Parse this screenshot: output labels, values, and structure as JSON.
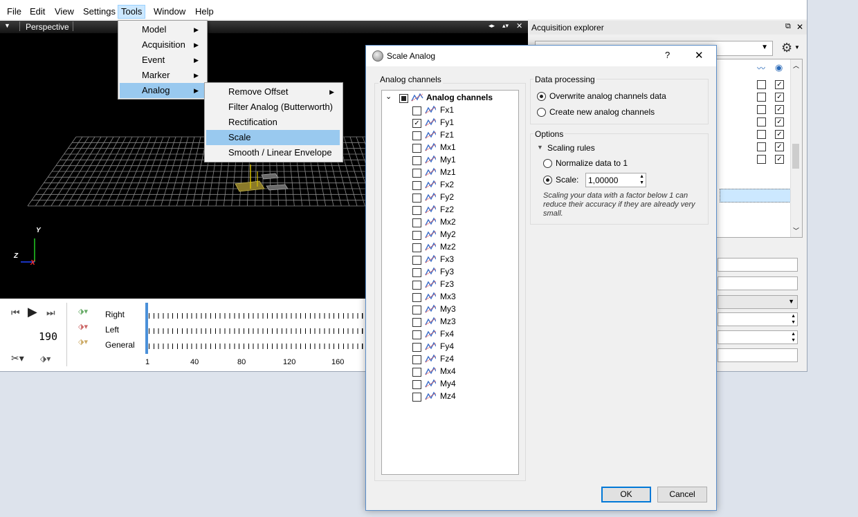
{
  "menubar": {
    "items": [
      "File",
      "Edit",
      "View",
      "Settings",
      "Tools",
      "Window",
      "Help"
    ]
  },
  "viewport": {
    "title": "Perspective",
    "axes": {
      "y": "Y",
      "z": "Z",
      "x": "X"
    }
  },
  "tools_menu": {
    "items": [
      {
        "label": "Model",
        "submenu": true
      },
      {
        "label": "Acquisition",
        "submenu": true
      },
      {
        "label": "Event",
        "submenu": true
      },
      {
        "label": "Marker",
        "submenu": true
      },
      {
        "label": "Analog",
        "submenu": true
      }
    ]
  },
  "analog_menu": {
    "items": [
      {
        "label": "Remove Offset",
        "submenu": true
      },
      {
        "label": "Filter Analog (Butterworth)",
        "submenu": false
      },
      {
        "label": "Rectification",
        "submenu": false
      },
      {
        "label": "Scale",
        "submenu": false
      },
      {
        "label": "Smooth / Linear Envelope",
        "submenu": false
      }
    ],
    "selected": "Scale"
  },
  "timeline": {
    "frame": "190",
    "tracks": [
      "Right",
      "Left",
      "General"
    ],
    "ticks": [
      "1",
      "40",
      "80",
      "120",
      "160"
    ]
  },
  "acquisition_explorer": {
    "title": "Acquisition explorer",
    "checkbox_rows": [
      {
        "a": false,
        "b": true
      },
      {
        "a": false,
        "b": true
      },
      {
        "a": false,
        "b": true
      },
      {
        "a": false,
        "b": true
      },
      {
        "a": false,
        "b": true
      },
      {
        "a": false,
        "b": true
      },
      {
        "a": false,
        "b": true
      }
    ]
  },
  "dialog": {
    "title": "Scale Analog",
    "help": "?",
    "close": "✕",
    "analog_group_title": "Analog channels",
    "tree_root": "Analog channels",
    "channels": [
      {
        "label": "Fx1",
        "checked": false
      },
      {
        "label": "Fy1",
        "checked": true
      },
      {
        "label": "Fz1",
        "checked": false
      },
      {
        "label": "Mx1",
        "checked": false
      },
      {
        "label": "My1",
        "checked": false
      },
      {
        "label": "Mz1",
        "checked": false
      },
      {
        "label": "Fx2",
        "checked": false
      },
      {
        "label": "Fy2",
        "checked": false
      },
      {
        "label": "Fz2",
        "checked": false
      },
      {
        "label": "Mx2",
        "checked": false
      },
      {
        "label": "My2",
        "checked": false
      },
      {
        "label": "Mz2",
        "checked": false
      },
      {
        "label": "Fx3",
        "checked": false
      },
      {
        "label": "Fy3",
        "checked": false
      },
      {
        "label": "Fz3",
        "checked": false
      },
      {
        "label": "Mx3",
        "checked": false
      },
      {
        "label": "My3",
        "checked": false
      },
      {
        "label": "Mz3",
        "checked": false
      },
      {
        "label": "Fx4",
        "checked": false
      },
      {
        "label": "Fy4",
        "checked": false
      },
      {
        "label": "Fz4",
        "checked": false
      },
      {
        "label": "Mx4",
        "checked": false
      },
      {
        "label": "My4",
        "checked": false
      },
      {
        "label": "Mz4",
        "checked": false
      }
    ],
    "data_processing": {
      "title": "Data processing",
      "overwrite": "Overwrite analog channels data",
      "create_new": "Create new analog channels",
      "selected": "overwrite"
    },
    "options": {
      "title": "Options",
      "scaling_rules": "Scaling rules",
      "normalize": "Normalize data to 1",
      "scale_label": "Scale:",
      "scale_value": "1,00000",
      "selected": "scale",
      "note": "Scaling your data with a factor below 1 can reduce their accuracy if they are already very small."
    },
    "ok": "OK",
    "cancel": "Cancel"
  },
  "colors": {
    "accent": "#0078d7",
    "menu_highlight": "#99c9ef",
    "viewport_bg": "#000000"
  }
}
